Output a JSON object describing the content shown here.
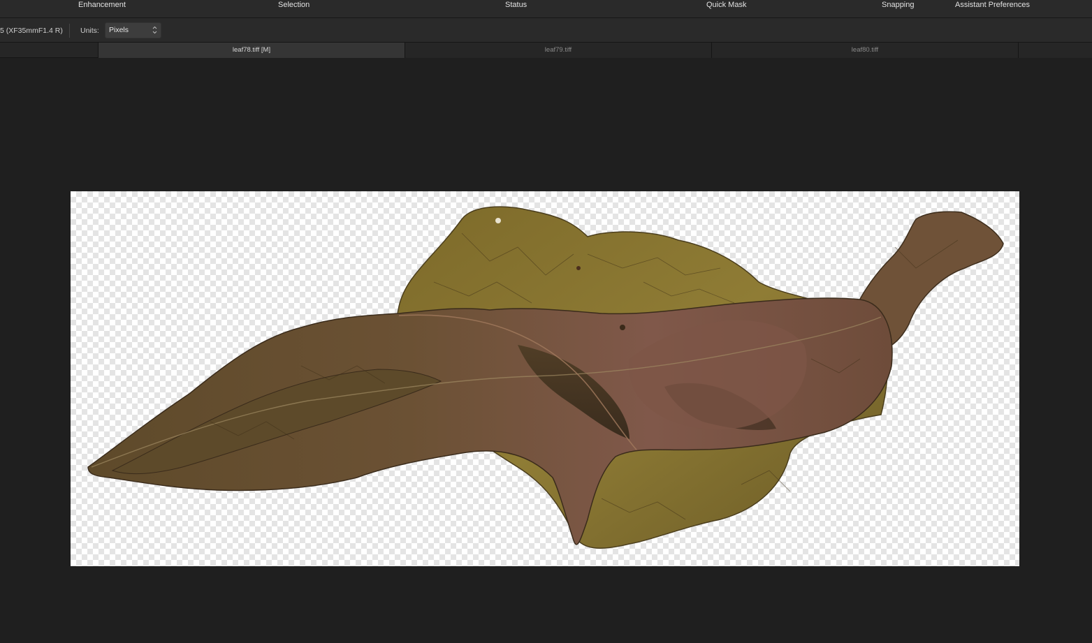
{
  "menu": {
    "items": [
      "Enhancement",
      "Selection",
      "Status",
      "Quick Mask",
      "Snapping",
      "Assistant Preferences"
    ]
  },
  "context_toolbar": {
    "lens_info": "5 (XF35mmF1.4 R)",
    "units_label": "Units:",
    "units_value": "Pixels"
  },
  "tabs": [
    {
      "label": "leaf78.tiff [M]",
      "active": true
    },
    {
      "label": "leaf79.tiff",
      "active": false
    },
    {
      "label": "leaf80.tiff",
      "active": false
    }
  ],
  "document": {
    "content": "leaf-image",
    "background": "transparency-checkerboard"
  },
  "colors": {
    "ui_background": "#1f1f1f",
    "toolbar": "#2a2a2a",
    "active_tab": "#353535",
    "leaf_brown": "#6b5030",
    "leaf_olive": "#8a7a32",
    "leaf_reddish": "#7a5446"
  }
}
